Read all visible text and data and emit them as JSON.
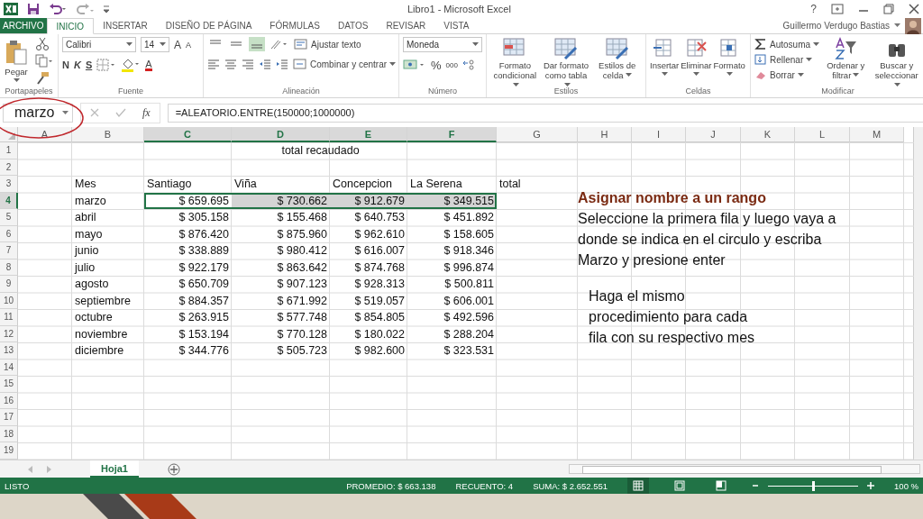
{
  "title_bar": {
    "title": "Libro1 - Microsoft Excel",
    "help": "?",
    "user": "Guillermo Verdugo Bastias"
  },
  "tabs": [
    {
      "label": "ARCHIVO",
      "kind": "file",
      "selected": false
    },
    {
      "label": "INICIO",
      "kind": "tab",
      "selected": true
    },
    {
      "label": "INSERTAR",
      "kind": "tab",
      "selected": false
    },
    {
      "label": "DISEÑO DE PÁGINA",
      "kind": "tab",
      "selected": false
    },
    {
      "label": "FÓRMULAS",
      "kind": "tab",
      "selected": false
    },
    {
      "label": "DATOS",
      "kind": "tab",
      "selected": false
    },
    {
      "label": "REVISAR",
      "kind": "tab",
      "selected": false
    },
    {
      "label": "VISTA",
      "kind": "tab",
      "selected": false
    }
  ],
  "ribbon": {
    "clipboard": {
      "label": "Portapapeles",
      "paste": "Pegar"
    },
    "font": {
      "label": "Fuente",
      "family": "Calibri",
      "size": "14",
      "grow": "A",
      "shrink": "A",
      "bold": "N",
      "italic": "K",
      "underline": "S",
      "font_color": "A"
    },
    "alignment": {
      "label": "Alineación",
      "vertical": [
        {
          "selected": false
        },
        {
          "selected": false
        },
        {
          "selected": true
        }
      ],
      "wrap": "Ajustar texto",
      "merge": "Combinar y centrar"
    },
    "number": {
      "label": "Número",
      "format": "Moneda",
      "percent": "%",
      "thousands": "000"
    },
    "styles": {
      "label": "Estilos",
      "buttons": [
        "Formato condicional",
        "Dar formato como tabla",
        "Estilos de celda"
      ]
    },
    "cells": {
      "label": "Celdas",
      "buttons": [
        "Insertar",
        "Eliminar",
        "Formato"
      ]
    },
    "editing": {
      "label": "Modificar",
      "small": [
        "Autosuma",
        "Rellenar",
        "Borrar"
      ],
      "buttons": [
        "Ordenar y filtrar",
        "Buscar y seleccionar"
      ]
    }
  },
  "formula_bar": {
    "name_box": "marzo",
    "fx": "fx",
    "formula": "=ALEATORIO.ENTRE(150000;1000000)"
  },
  "sheet": {
    "columns": [
      {
        "label": "A",
        "selected": false
      },
      {
        "label": "B",
        "selected": false
      },
      {
        "label": "C",
        "selected": true
      },
      {
        "label": "D",
        "selected": true
      },
      {
        "label": "E",
        "selected": true
      },
      {
        "label": "F",
        "selected": true
      },
      {
        "label": "G",
        "selected": false
      },
      {
        "label": "H",
        "selected": false
      },
      {
        "label": "I",
        "selected": false
      },
      {
        "label": "J",
        "selected": false
      },
      {
        "label": "K",
        "selected": false
      },
      {
        "label": "L",
        "selected": false
      },
      {
        "label": "M",
        "selected": false
      }
    ],
    "row_numbers": [
      {
        "label": "1",
        "selected": false
      },
      {
        "label": "2",
        "selected": false
      },
      {
        "label": "3",
        "selected": false
      },
      {
        "label": "4",
        "selected": true
      },
      {
        "label": "5",
        "selected": false
      },
      {
        "label": "6",
        "selected": false
      },
      {
        "label": "7",
        "selected": false
      },
      {
        "label": "8",
        "selected": false
      },
      {
        "label": "9",
        "selected": false
      },
      {
        "label": "10",
        "selected": false
      },
      {
        "label": "11",
        "selected": false
      },
      {
        "label": "12",
        "selected": false
      },
      {
        "label": "13",
        "selected": false
      },
      {
        "label": "14",
        "selected": false
      },
      {
        "label": "15",
        "selected": false
      },
      {
        "label": "16",
        "selected": false
      },
      {
        "label": "17",
        "selected": false
      },
      {
        "label": "18",
        "selected": false
      },
      {
        "label": "19",
        "selected": false
      }
    ],
    "title": "total recaudado",
    "headers": [
      "Mes",
      "Santiago",
      "Viña",
      "Concepcion",
      "La Serena",
      "total"
    ],
    "rows": [
      {
        "month": "marzo",
        "values": [
          "$ 659.695",
          "$ 730.662",
          "$ 912.679",
          "$ 349.515"
        ],
        "selected": true
      },
      {
        "month": "abril",
        "values": [
          "$ 305.158",
          "$ 155.468",
          "$ 640.753",
          "$ 451.892"
        ],
        "selected": false
      },
      {
        "month": "mayo",
        "values": [
          "$ 876.420",
          "$ 875.960",
          "$ 962.610",
          "$ 158.605"
        ],
        "selected": false
      },
      {
        "month": "junio",
        "values": [
          "$ 338.889",
          "$ 980.412",
          "$ 616.007",
          "$ 918.346"
        ],
        "selected": false
      },
      {
        "month": "julio",
        "values": [
          "$ 922.179",
          "$ 863.642",
          "$ 874.768",
          "$ 996.874"
        ],
        "selected": false
      },
      {
        "month": "agosto",
        "values": [
          "$ 650.709",
          "$ 907.123",
          "$ 928.313",
          "$ 500.811"
        ],
        "selected": false
      },
      {
        "month": "septiembre",
        "values": [
          "$ 884.357",
          "$ 671.992",
          "$ 519.057",
          "$ 606.001"
        ],
        "selected": false
      },
      {
        "month": "octubre",
        "values": [
          "$ 263.915",
          "$ 577.748",
          "$ 854.805",
          "$ 492.596"
        ],
        "selected": false
      },
      {
        "month": "noviembre",
        "values": [
          "$ 153.194",
          "$ 770.128",
          "$ 180.022",
          "$ 288.204"
        ],
        "selected": false
      },
      {
        "month": "diciembre",
        "values": [
          "$ 344.776",
          "$ 505.723",
          "$ 982.600",
          "$ 323.531"
        ],
        "selected": false
      }
    ]
  },
  "notes": {
    "heading": "Asignar nombre a un rango",
    "instruction_lines": [
      "Seleccione la primera fila y luego vaya a",
      "donde se indica en el circulo y escriba",
      "Marzo y presione enter"
    ],
    "tip_lines": [
      "Haga el mismo",
      "procedimiento para cada",
      "fila con su respectivo mes"
    ]
  },
  "sheet_tabs": [
    {
      "label": "Hoja1",
      "selected": true
    }
  ],
  "status_bar": {
    "state": "LISTO",
    "average": "PROMEDIO: $ 663.138",
    "count": "RECUENTO: 4",
    "sum": "SUMA: $ 2.652.551",
    "views": [
      {
        "kind": "normal",
        "selected": true
      },
      {
        "kind": "layout",
        "selected": false
      },
      {
        "kind": "break",
        "selected": false
      }
    ],
    "zoom": {
      "level": 0.5,
      "reading": "100 %"
    }
  }
}
